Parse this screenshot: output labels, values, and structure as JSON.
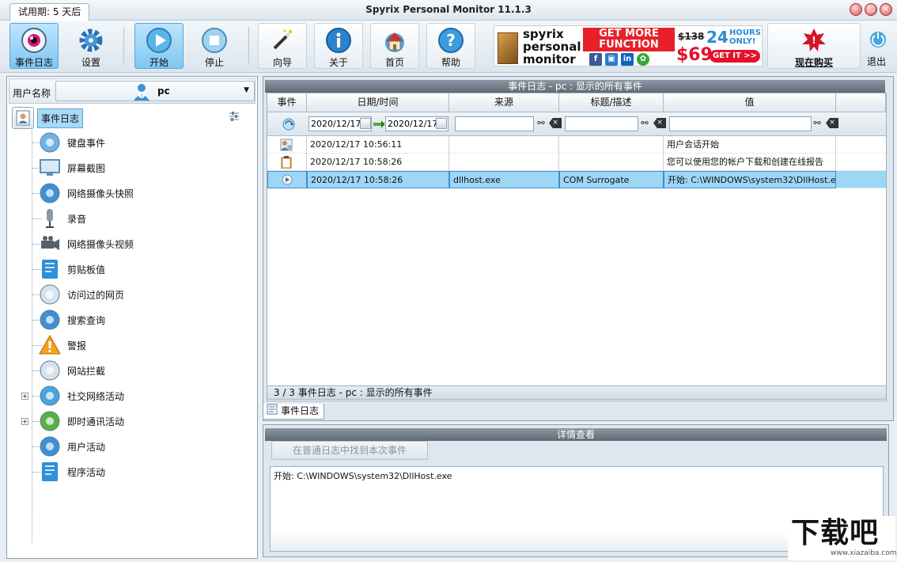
{
  "window": {
    "trial_tab": "试用期: 5 天后",
    "title": "Spyrix Personal Monitor 11.1.3"
  },
  "toolbar": {
    "event_log": "事件日志",
    "settings": "设置",
    "start": "开始",
    "stop": "停止",
    "wizard": "向导",
    "about": "关于",
    "home": "首页",
    "help": "帮助",
    "buy_now": "现在购买",
    "exit": "退出"
  },
  "ad": {
    "brand_line1": "spyrix",
    "brand_line2": "personal",
    "brand_line3": "monitor",
    "headline1": "GET MORE",
    "headline2": "FUNCTION",
    "old_price": "$138",
    "price": "$69",
    "hours": "24",
    "hours_suffix1": "HOURS",
    "hours_suffix2": "ONLY!",
    "cta": "GET IT >>"
  },
  "left": {
    "user_label": "用户名称",
    "user_value": "pc",
    "root": "事件日志",
    "items": [
      {
        "label": "键盘事件",
        "icon": "keyboard-icon"
      },
      {
        "label": "屏幕截图",
        "icon": "screenshot-icon"
      },
      {
        "label": "网络摄像头快照",
        "icon": "webcam-icon"
      },
      {
        "label": "录音",
        "icon": "microphone-icon"
      },
      {
        "label": "网络摄像头视频",
        "icon": "video-camera-icon"
      },
      {
        "label": "剪贴板值",
        "icon": "clipboard-icon"
      },
      {
        "label": "访问过的网页",
        "icon": "globe-icon"
      },
      {
        "label": "搜索查询",
        "icon": "search-icon"
      },
      {
        "label": "警报",
        "icon": "warning-icon"
      },
      {
        "label": "网站拦截",
        "icon": "block-site-icon"
      },
      {
        "label": "社交网络活动",
        "icon": "social-network-icon"
      },
      {
        "label": "即时通讯活动",
        "icon": "chat-icon"
      },
      {
        "label": "用户活动",
        "icon": "user-activity-icon"
      },
      {
        "label": "程序活动",
        "icon": "program-activity-icon"
      }
    ]
  },
  "grid": {
    "title": "事件日志 - pc : 显示的所有事件",
    "columns": [
      "事件",
      "日期/时间",
      "来源",
      "标题/描述",
      "值"
    ],
    "filter": {
      "date_from": "2020/12/17",
      "date_to": "2020/12/17"
    },
    "rows": [
      {
        "datetime": "2020/12/17 10:56:11",
        "source": "",
        "title": "",
        "value": "用户会话开始"
      },
      {
        "datetime": "2020/12/17 10:58:26",
        "source": "",
        "title": "",
        "value": "您可以使用您的帐户下载和创建在线报告"
      },
      {
        "datetime": "2020/12/17 10:58:26",
        "source": "dllhost.exe",
        "title": "COM Surrogate",
        "value": "开始: C:\\WINDOWS\\system32\\DllHost.exe"
      }
    ],
    "status": "3 / 3    事件日志 - pc : 显示的所有事件"
  },
  "tab": {
    "label": "事件日志"
  },
  "detail": {
    "title": "详情查看",
    "find_button": "在普通日志中找到本次事件",
    "body": "开始: C:\\WINDOWS\\system32\\DllHost.exe"
  },
  "watermark": {
    "text": "下载吧",
    "url": "www.xiazaiba.com"
  }
}
